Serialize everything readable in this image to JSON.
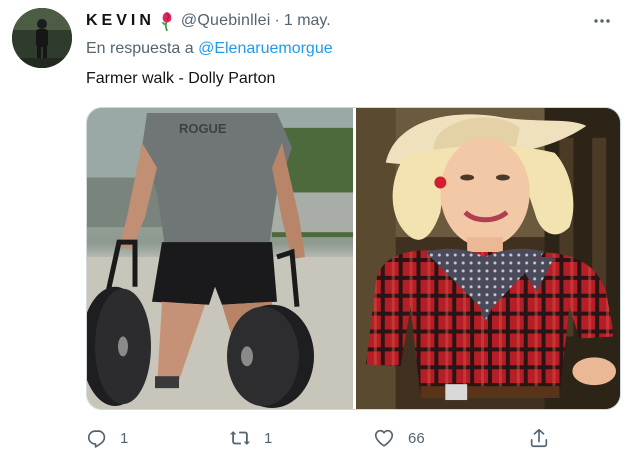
{
  "tweet": {
    "display_name": "KEVIN",
    "name_emoji_icon": "rose-icon",
    "handle": "@Quebinllei",
    "separator": "·",
    "date": "1 may.",
    "reply_prefix": "En respuesta a",
    "reply_to": "@Elenaruemorgue",
    "text": "Farmer walk - Dolly Parton"
  },
  "media": {
    "left_image": {
      "shirt_text": "ROGUE"
    },
    "right_image": {}
  },
  "actions": {
    "reply": {
      "icon": "reply-icon",
      "count": "1"
    },
    "retweet": {
      "icon": "retweet-icon",
      "count": "1"
    },
    "like": {
      "icon": "heart-icon",
      "count": "66"
    },
    "share": {
      "icon": "share-icon"
    }
  },
  "colors": {
    "link": "#1d9bf0",
    "secondary_text": "#536471",
    "primary_text": "#0f1419"
  }
}
